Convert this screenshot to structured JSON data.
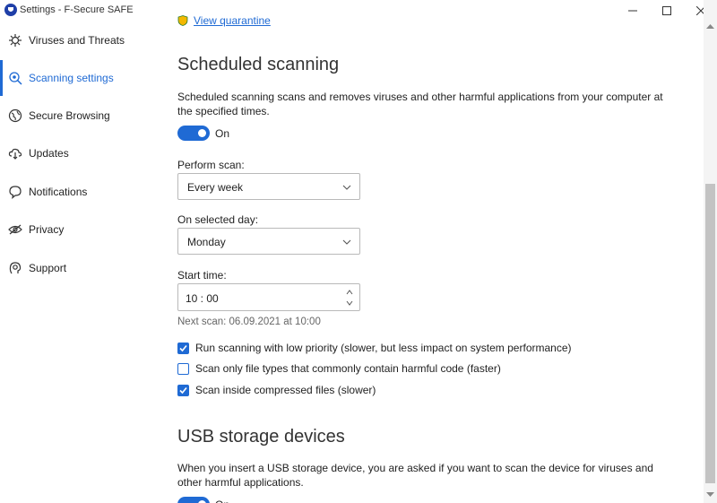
{
  "window": {
    "title": "Settings - F-Secure SAFE",
    "controls": [
      "minimize",
      "maximize",
      "close"
    ],
    "accent_color": "#1f6ad4"
  },
  "sidebar": {
    "items": [
      {
        "label": "Viruses and Threats",
        "icon": "virus-icon"
      },
      {
        "label": "Scanning settings",
        "icon": "scan-icon",
        "active": true
      },
      {
        "label": "Secure Browsing",
        "icon": "globe-icon"
      },
      {
        "label": "Updates",
        "icon": "cloud-download-icon"
      },
      {
        "label": "Notifications",
        "icon": "chat-bubble-icon"
      },
      {
        "label": "Privacy",
        "icon": "eye-slash-icon"
      },
      {
        "label": "Support",
        "icon": "support-icon"
      }
    ]
  },
  "main": {
    "quarantine_link": "View quarantine",
    "scheduled": {
      "heading": "Scheduled scanning",
      "description": "Scheduled scanning scans and removes viruses and other harmful applications from your computer at the specified times.",
      "toggle_label": "On",
      "toggle_on": true,
      "perform_label": "Perform scan:",
      "perform_value": "Every week",
      "day_label": "On selected day:",
      "day_value": "Monday",
      "time_label": "Start time:",
      "time_value": "10 : 00",
      "next_scan": "Next scan: 06.09.2021 at 10:00"
    },
    "options": [
      {
        "label": "Run scanning with low priority (slower, but less impact on system performance)",
        "checked": true
      },
      {
        "label": "Scan only file types that commonly contain harmful code (faster)",
        "checked": false
      },
      {
        "label": "Scan inside compressed files (slower)",
        "checked": true
      }
    ],
    "usb": {
      "heading": "USB storage devices",
      "description": "When you insert a USB storage device, you are asked if you want to scan the device for viruses and other harmful applications.",
      "toggle_label": "On"
    }
  }
}
